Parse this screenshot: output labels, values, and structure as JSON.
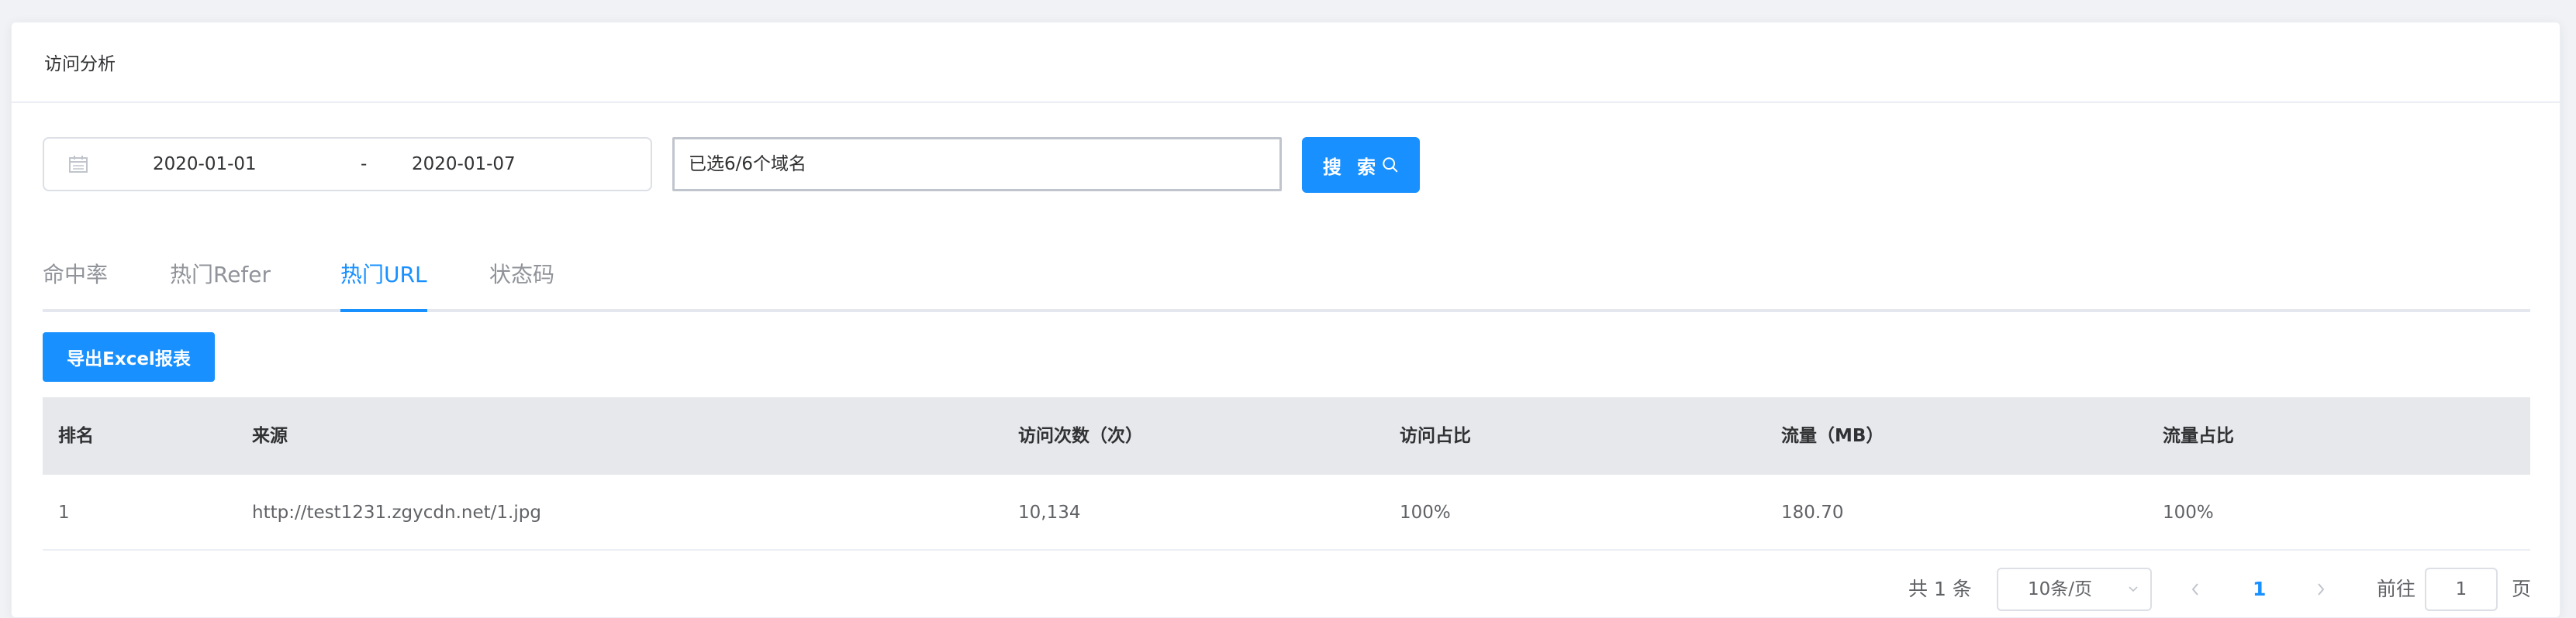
{
  "header": {
    "title": "访问分析"
  },
  "filter": {
    "start_date": "2020-01-01",
    "separator": "-",
    "end_date": "2020-01-07",
    "domain_select": "已选6/6个域名",
    "search_label": "搜 索"
  },
  "tabs": [
    {
      "label": "命中率",
      "active": false
    },
    {
      "label": "热门Refer",
      "active": false
    },
    {
      "label": "热门URL",
      "active": true
    },
    {
      "label": "状态码",
      "active": false
    }
  ],
  "export_label": "导出Excel报表",
  "table": {
    "columns": [
      "排名",
      "来源",
      "访问次数（次）",
      "访问占比",
      "流量（MB）",
      "流量占比"
    ],
    "rows": [
      [
        "1",
        "http://test1231.zgycdn.net/1.jpg",
        "10,134",
        "100%",
        "180.70",
        "100%"
      ]
    ]
  },
  "pagination": {
    "total": "共 1 条",
    "page_size": "10条/页",
    "current_page": "1",
    "goto_label": "前往",
    "goto_value": "1",
    "page_unit": "页"
  },
  "colors": {
    "accent": "#1890ff",
    "header_bg": "#e6e8eb"
  }
}
